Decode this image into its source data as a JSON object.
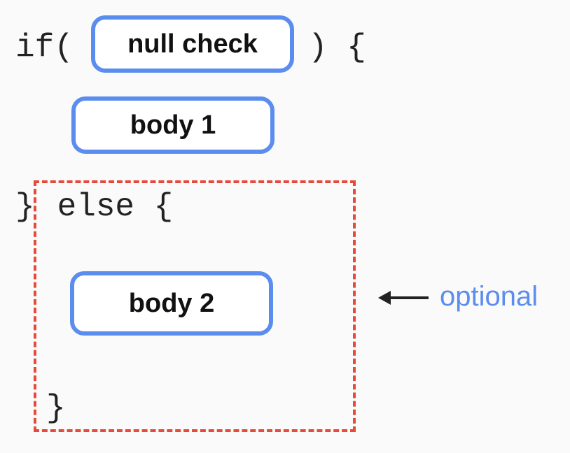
{
  "code": {
    "if_left": "if(",
    "if_right": ") {",
    "else_brace_close": "}",
    "else_keyword": " else {",
    "final_brace": "}"
  },
  "boxes": {
    "null_check": "null check",
    "body1": "body 1",
    "body2": "body 2"
  },
  "annotation": {
    "optional": "optional"
  }
}
